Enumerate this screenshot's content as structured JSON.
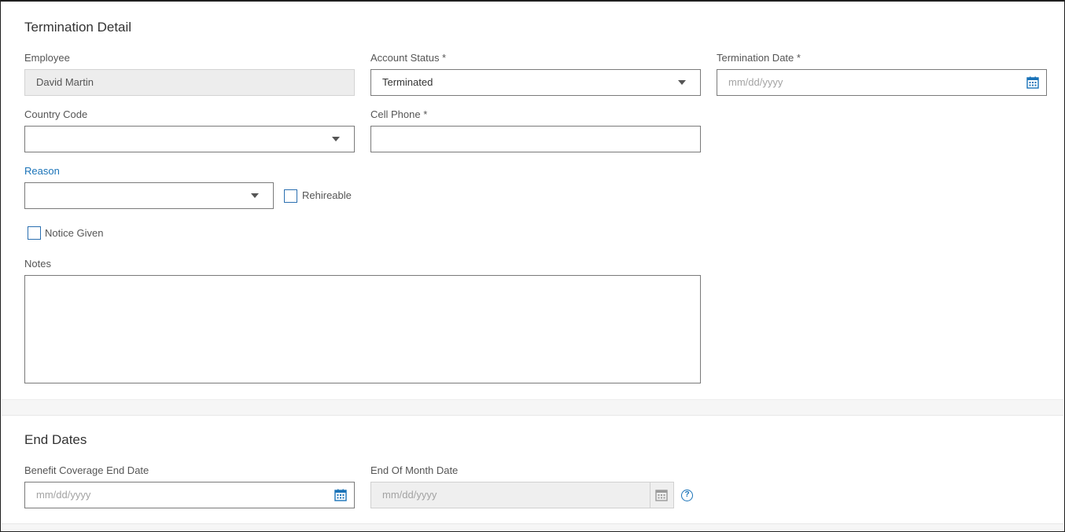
{
  "termination_detail": {
    "title": "Termination Detail",
    "employee": {
      "label": "Employee",
      "value": "David Martin"
    },
    "account_status": {
      "label": "Account Status *",
      "value": "Terminated"
    },
    "termination_date": {
      "label": "Termination Date *",
      "placeholder": "mm/dd/yyyy"
    },
    "country_code": {
      "label": "Country Code",
      "value": ""
    },
    "cell_phone": {
      "label": "Cell Phone *",
      "value": ""
    },
    "reason": {
      "label": "Reason",
      "value": ""
    },
    "rehireable": {
      "label": "Rehireable",
      "checked": false
    },
    "notice_given": {
      "label": "Notice Given",
      "checked": false
    },
    "notes": {
      "label": "Notes",
      "value": ""
    }
  },
  "end_dates": {
    "title": "End Dates",
    "benefit_coverage_end_date": {
      "label": "Benefit Coverage End Date",
      "placeholder": "mm/dd/yyyy"
    },
    "end_of_month_date": {
      "label": "End Of Month Date",
      "placeholder": "mm/dd/yyyy"
    },
    "help_icon": "?"
  },
  "icons": {
    "calendar": "calendar-icon",
    "dropdown": "chevron-down-icon",
    "help": "help-circle-icon"
  },
  "colors": {
    "accent": "#1a73b8",
    "border": "#7a7a7a",
    "readonly_bg": "#ededed",
    "section_band": "#f6f6f6"
  }
}
